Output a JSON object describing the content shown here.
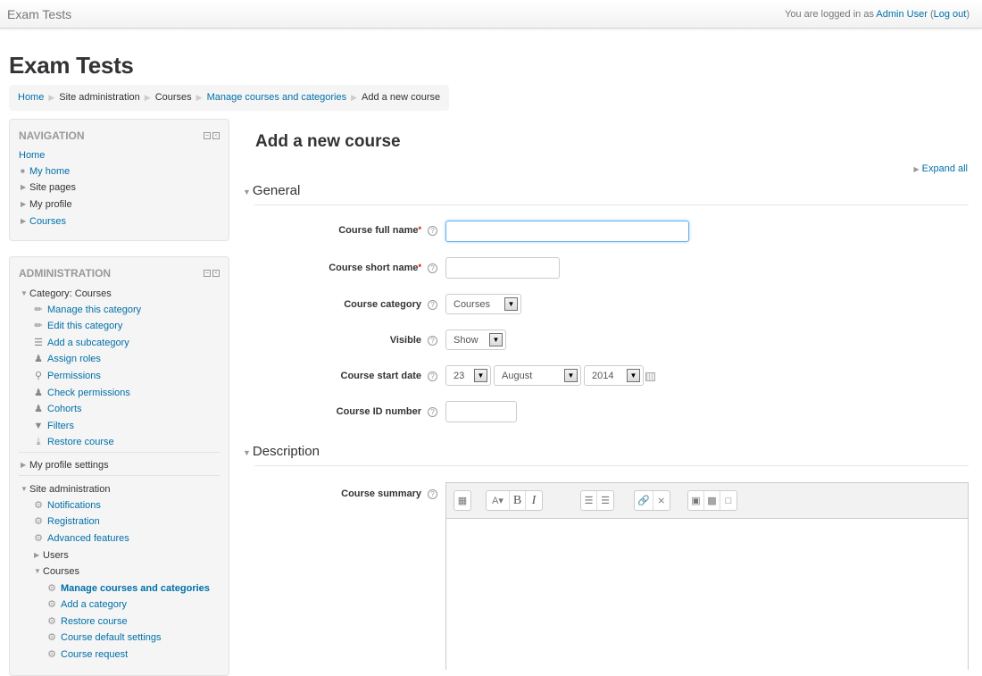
{
  "navbar": {
    "brand": "Exam Tests",
    "login_prefix": "You are logged in as ",
    "user_name": "Admin User",
    "logout_open": " (",
    "logout_label": "Log out",
    "logout_close": ")"
  },
  "page_title": "Exam Tests",
  "breadcrumb": [
    {
      "label": "Home",
      "link": true
    },
    {
      "label": "Site administration",
      "link": false
    },
    {
      "label": "Courses",
      "link": false
    },
    {
      "label": "Manage courses and categories",
      "link": true
    },
    {
      "label": "Add a new course",
      "link": false
    }
  ],
  "navigation": {
    "title": "NAVIGATION",
    "home": "Home",
    "items": [
      {
        "label": "My home",
        "marker": "bullet",
        "link": true
      },
      {
        "label": "Site pages",
        "marker": "arrow",
        "link": false
      },
      {
        "label": "My profile",
        "marker": "arrow",
        "link": false
      },
      {
        "label": "Courses",
        "marker": "arrow",
        "link": true
      }
    ]
  },
  "administration": {
    "title": "ADMINISTRATION",
    "category": {
      "label": "Category: Courses",
      "items": [
        {
          "label": "Manage this category",
          "icon": "pencil-icon"
        },
        {
          "label": "Edit this category",
          "icon": "pencil-icon"
        },
        {
          "label": "Add a subcategory",
          "icon": "list-icon"
        },
        {
          "label": "Assign roles",
          "icon": "user-icon"
        },
        {
          "label": "Permissions",
          "icon": "key-icon"
        },
        {
          "label": "Check permissions",
          "icon": "user-check-icon"
        },
        {
          "label": "Cohorts",
          "icon": "users-icon"
        },
        {
          "label": "Filters",
          "icon": "filter-icon"
        },
        {
          "label": "Restore course",
          "icon": "restore-icon"
        }
      ]
    },
    "my_profile_settings": "My profile settings",
    "site_admin": {
      "label": "Site administration",
      "items": [
        {
          "label": "Notifications"
        },
        {
          "label": "Registration"
        },
        {
          "label": "Advanced features"
        }
      ],
      "users": "Users",
      "courses": {
        "label": "Courses",
        "items": [
          {
            "label": "Manage courses and categories",
            "active": true
          },
          {
            "label": "Add a category"
          },
          {
            "label": "Restore course"
          },
          {
            "label": "Course default settings"
          },
          {
            "label": "Course request"
          }
        ]
      }
    }
  },
  "main": {
    "title": "Add a new course",
    "expand_all": "Expand all",
    "sections": {
      "general": "General",
      "description": "Description"
    },
    "fields": {
      "full_name": {
        "label": "Course full name",
        "value": "",
        "required": "*"
      },
      "short_name": {
        "label": "Course short name",
        "value": "",
        "required": "*"
      },
      "category": {
        "label": "Course category",
        "value": "Courses"
      },
      "visible": {
        "label": "Visible",
        "value": "Show"
      },
      "start_date": {
        "label": "Course start date",
        "day": "23",
        "month": "August",
        "year": "2014"
      },
      "id_number": {
        "label": "Course ID number",
        "value": ""
      },
      "summary": {
        "label": "Course summary"
      }
    },
    "help_glyph": "?",
    "editor_toolbar": [
      [
        "toggle-toolbar"
      ],
      [
        "font-style",
        "bold",
        "italic"
      ],
      [
        "unordered-list",
        "ordered-list"
      ],
      [
        "link",
        "unlink"
      ],
      [
        "image",
        "media",
        "manage-files"
      ]
    ]
  }
}
